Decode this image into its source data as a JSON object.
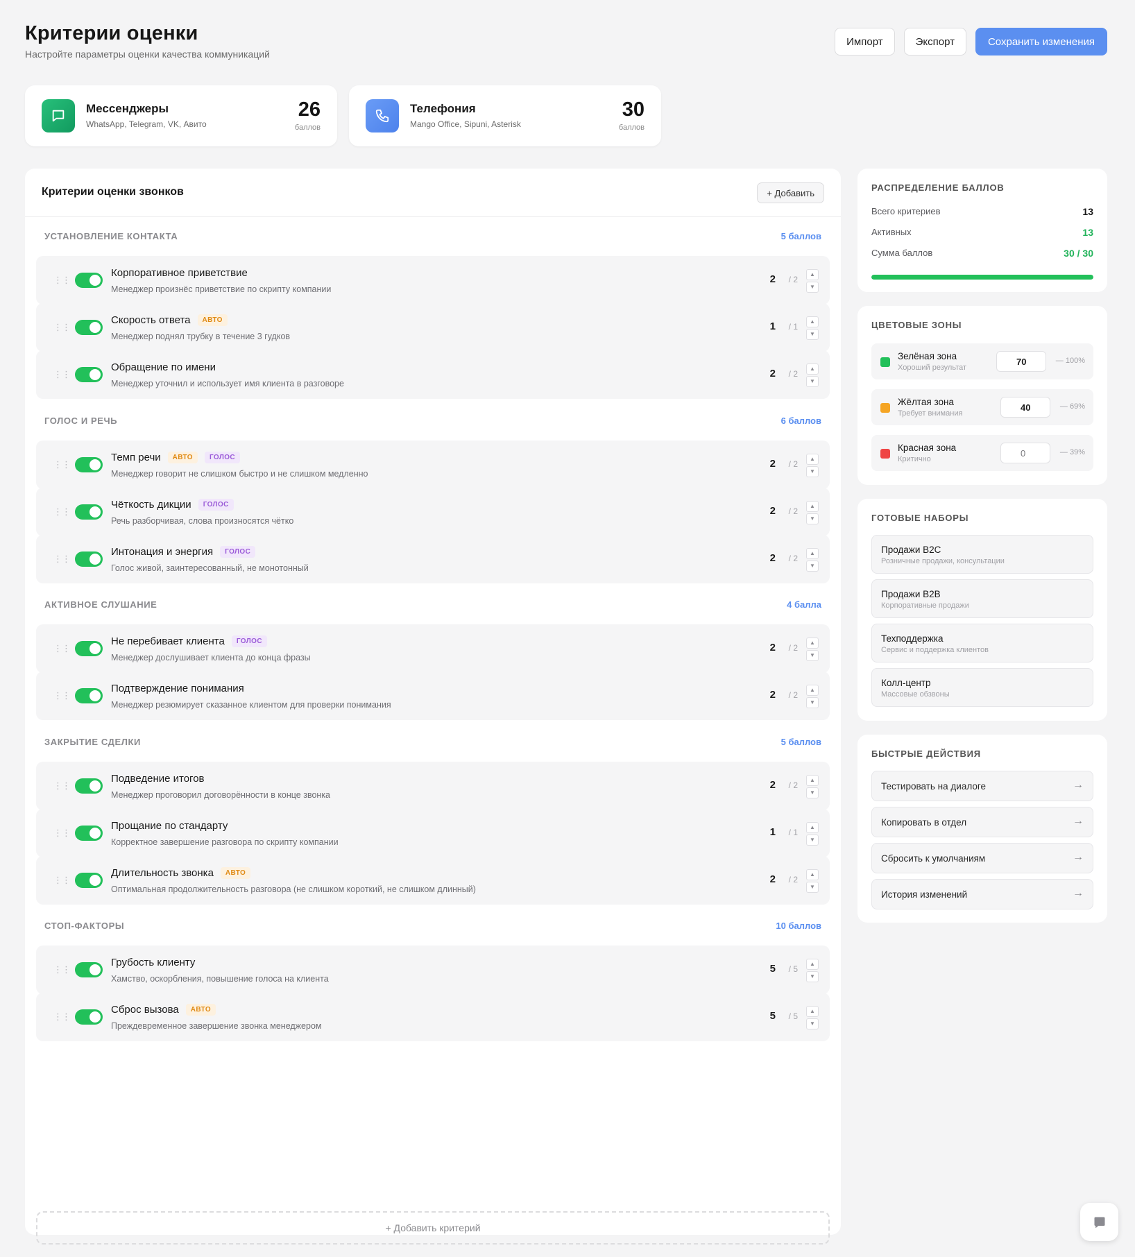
{
  "header": {
    "title": "Критерии оценки",
    "subtitle": "Настройте параметры оценки качества коммуникаций",
    "import_label": "Импорт",
    "export_label": "Экспорт",
    "save_label": "Сохранить изменения"
  },
  "channels": [
    {
      "title": "Мессенджеры",
      "desc": "WhatsApp, Telegram, VK, Авито",
      "points": "26",
      "points_label": "баллов",
      "icon": "chat-icon",
      "color": "#1fae6a"
    },
    {
      "title": "Телефония",
      "desc": "Mango Office, Sipuni, Asterisk",
      "points": "30",
      "points_label": "баллов",
      "icon": "phone-icon",
      "color": "#5b8ff0"
    }
  ],
  "criteria": {
    "title": "Критерии оценки звонков",
    "add_label": "+ Добавить",
    "add_criteria_label": "+ Добавить критерий",
    "tags": {
      "auto": "АВТО",
      "voice": "ГОЛОС"
    },
    "sections": [
      {
        "name": "УСТАНОВЛЕНИЕ КОНТАКТА",
        "points": "5 баллов",
        "items": [
          {
            "title": "Корпоративное приветствие",
            "desc": "Менеджер произнёс приветствие по скрипту компании",
            "score": "2",
            "max": "/ 2"
          },
          {
            "title": "Скорость ответа",
            "desc": "Менеджер поднял трубку в течение 3 гудков",
            "score": "1",
            "max": "/ 1"
          },
          {
            "title": "Обращение по имени",
            "desc": "Менеджер уточнил и использует имя клиента в разговоре",
            "score": "2",
            "max": "/ 2"
          }
        ]
      },
      {
        "name": "ГОЛОС И РЕЧЬ",
        "points": "6 баллов",
        "items": [
          {
            "title": "Темп речи",
            "desc": "Менеджер говорит не слишком быстро и не слишком медленно",
            "score": "2",
            "max": "/ 2"
          },
          {
            "title": "Чёткость дикции",
            "desc": "Речь разборчивая, слова произносятся чётко",
            "score": "2",
            "max": "/ 2"
          },
          {
            "title": "Интонация и энергия",
            "desc": "Голос живой, заинтересованный, не монотонный",
            "score": "2",
            "max": "/ 2"
          }
        ]
      },
      {
        "name": "АКТИВНОЕ СЛУШАНИЕ",
        "points": "4 балла",
        "items": [
          {
            "title": "Не перебивает клиента",
            "desc": "Менеджер дослушивает клиента до конца фразы",
            "score": "2",
            "max": "/ 2"
          },
          {
            "title": "Подтверждение понимания",
            "desc": "Менеджер резюмирует сказанное клиентом для проверки понимания",
            "score": "2",
            "max": "/ 2"
          }
        ]
      },
      {
        "name": "ЗАКРЫТИЕ СДЕЛКИ",
        "points": "5 баллов",
        "items": [
          {
            "title": "Подведение итогов",
            "desc": "Менеджер проговорил договорённости в конце звонка",
            "score": "2",
            "max": "/ 2"
          },
          {
            "title": "Прощание по стандарту",
            "desc": "Корректное завершение разговора по скрипту компании",
            "score": "1",
            "max": "/ 1"
          },
          {
            "title": "Длительность звонка",
            "desc": "Оптимальная продолжительность разговора (не слишком короткий, не слишком длинный)",
            "score": "2",
            "max": "/ 2"
          }
        ]
      },
      {
        "name": "СТОП-ФАКТОРЫ",
        "points": "10 баллов",
        "items": [
          {
            "title": "Грубость клиенту",
            "desc": "Хамство, оскорбления, повышение голоса на клиента",
            "score": "5",
            "max": "/ 5"
          },
          {
            "title": "Сброс вызова",
            "desc": "Преждевременное завершение звонка менеджером",
            "score": "5",
            "max": "/ 5"
          }
        ]
      }
    ]
  },
  "distribution": {
    "title": "РАСПРЕДЕЛЕНИЕ БАЛЛОВ",
    "total_label": "Всего критериев",
    "total": "13",
    "active_label": "Активных",
    "active": "13",
    "sum_label": "Сумма баллов",
    "sum": "30 / 30",
    "progress": 1.0
  },
  "zones": {
    "title": "ЦВЕТОВЫЕ ЗОНЫ",
    "items": [
      {
        "name": "Зелёная зона",
        "desc": "Хороший результат",
        "value": "70",
        "range": "— 100%",
        "color": "#22c05a"
      },
      {
        "name": "Жёлтая зона",
        "desc": "Требует внимания",
        "value": "40",
        "range": "— 69%",
        "color": "#f5a524"
      },
      {
        "name": "Красная зона",
        "desc": "Критично",
        "value": "0",
        "range": "— 39%",
        "color": "#ef4444"
      }
    ]
  },
  "presets": {
    "title": "ГОТОВЫЕ НАБОРЫ",
    "items": [
      {
        "name": "Продажи B2C",
        "desc": "Розничные продажи, консультации"
      },
      {
        "name": "Продажи B2B",
        "desc": "Корпоративные продажи"
      },
      {
        "name": "Техподдержка",
        "desc": "Сервис и поддержка клиентов"
      },
      {
        "name": "Колл-центр",
        "desc": "Массовые обзвоны"
      }
    ]
  },
  "quick_actions": {
    "title": "БЫСТРЫЕ ДЕЙСТВИЯ",
    "arrow": "→",
    "items": [
      {
        "name": "Тестировать на диалоге"
      },
      {
        "name": "Копировать в отдел"
      },
      {
        "name": "Сбросить к умолчаниям"
      },
      {
        "name": "История изменений"
      }
    ]
  }
}
